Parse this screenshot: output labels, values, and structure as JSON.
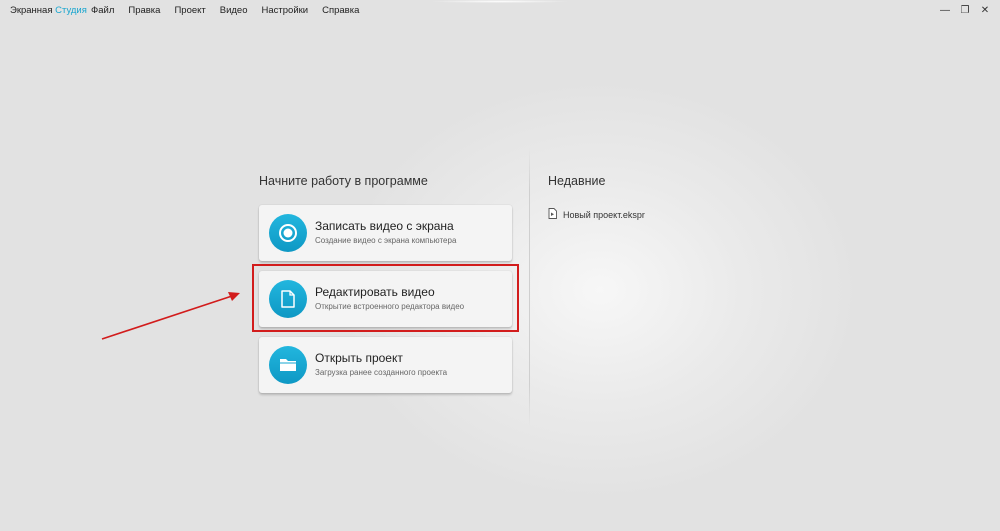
{
  "app": {
    "brand_main": "Экранная",
    "brand_accent": "Студия"
  },
  "menu": {
    "items": [
      {
        "label": "Файл"
      },
      {
        "label": "Правка"
      },
      {
        "label": "Проект"
      },
      {
        "label": "Видео"
      },
      {
        "label": "Настройки"
      },
      {
        "label": "Справка"
      }
    ]
  },
  "window_controls": {
    "minimize": "—",
    "restore": "❐",
    "close": "✕"
  },
  "start": {
    "heading": "Начните работу в программе",
    "cards": [
      {
        "title": "Записать видео с экрана",
        "subtitle": "Создание видео с экрана компьютера",
        "icon": "record-icon"
      },
      {
        "title": "Редактировать видео",
        "subtitle": "Открытие встроенного редактора видео",
        "icon": "file-icon"
      },
      {
        "title": "Открыть проект",
        "subtitle": "Загрузка ранее созданного проекта",
        "icon": "folder-icon"
      }
    ]
  },
  "recent": {
    "heading": "Недавние",
    "items": [
      {
        "label": "Новый проект.ekspr",
        "icon": "project-file-icon"
      }
    ]
  },
  "annotations": {
    "highlight_color": "#d21c1c",
    "arrow_color": "#d21c1c"
  },
  "colors": {
    "accent": "#1aa6cf",
    "icon_circle": "#14a7d2"
  }
}
